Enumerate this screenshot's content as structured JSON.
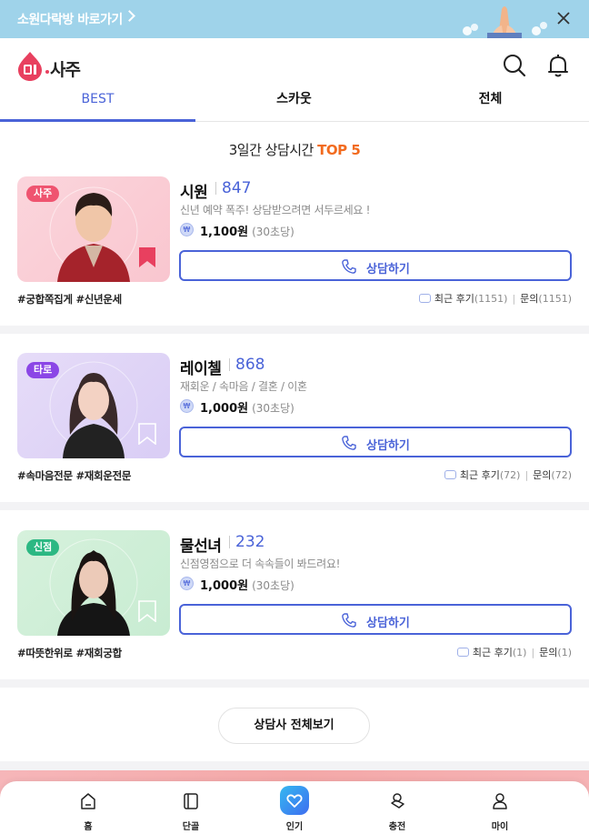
{
  "banner": {
    "text": "소원다락방 바로가기"
  },
  "header": {
    "logo_text": "사주"
  },
  "tabs": [
    {
      "label": "BEST",
      "active": true
    },
    {
      "label": "스카웃",
      "active": false
    },
    {
      "label": "전체",
      "active": false
    }
  ],
  "section": {
    "title_prefix": "3일간 상담시간 ",
    "title_highlight": "TOP 5"
  },
  "counselors": [
    {
      "category": "사주",
      "category_color": "#ef5470",
      "name": "시원",
      "count": "847",
      "description": "신년 예약 폭주! 상담받으려면 서두르세요 !",
      "price": "1,100원",
      "unit": "(30초당)",
      "button_label": "상담하기",
      "tags": "#궁합쪽집게 #신년운세",
      "review_label": "최근 후기",
      "review_count": "(1151)",
      "inquiry_label": "문의",
      "inquiry_count": "(1151)",
      "bookmarked": true
    },
    {
      "category": "타로",
      "category_color": "#8b46e6",
      "name": "레이첼",
      "count": "868",
      "description": "재회운 / 속마음 / 결혼 / 이혼",
      "price": "1,000원",
      "unit": "(30초당)",
      "button_label": "상담하기",
      "tags": "#속마음전문 #재회운전문",
      "review_label": "최근 후기",
      "review_count": "(72)",
      "inquiry_label": "문의",
      "inquiry_count": "(72)",
      "bookmarked": false
    },
    {
      "category": "신점",
      "category_color": "#2cb883",
      "name": "물선녀",
      "count": "232",
      "description": "신점영점으로 더 속속들이 봐드려요!",
      "price": "1,000원",
      "unit": "(30초당)",
      "button_label": "상담하기",
      "tags": "#따뜻한위로 #재회궁합",
      "review_label": "최근 후기",
      "review_count": "(1)",
      "inquiry_label": "문의",
      "inquiry_count": "(1)",
      "bookmarked": false
    }
  ],
  "more_button": "상담사 전체보기",
  "bottom_nav": [
    {
      "label": "홈",
      "icon": "home-icon"
    },
    {
      "label": "단골",
      "icon": "book-icon"
    },
    {
      "label": "인기",
      "icon": "heart-icon",
      "active": true
    },
    {
      "label": "충전",
      "icon": "coins-icon"
    },
    {
      "label": "마이",
      "icon": "user-icon"
    }
  ],
  "colors": {
    "accent": "#4a63d8",
    "highlight": "#f26b1f",
    "brand": "#e8405f"
  }
}
